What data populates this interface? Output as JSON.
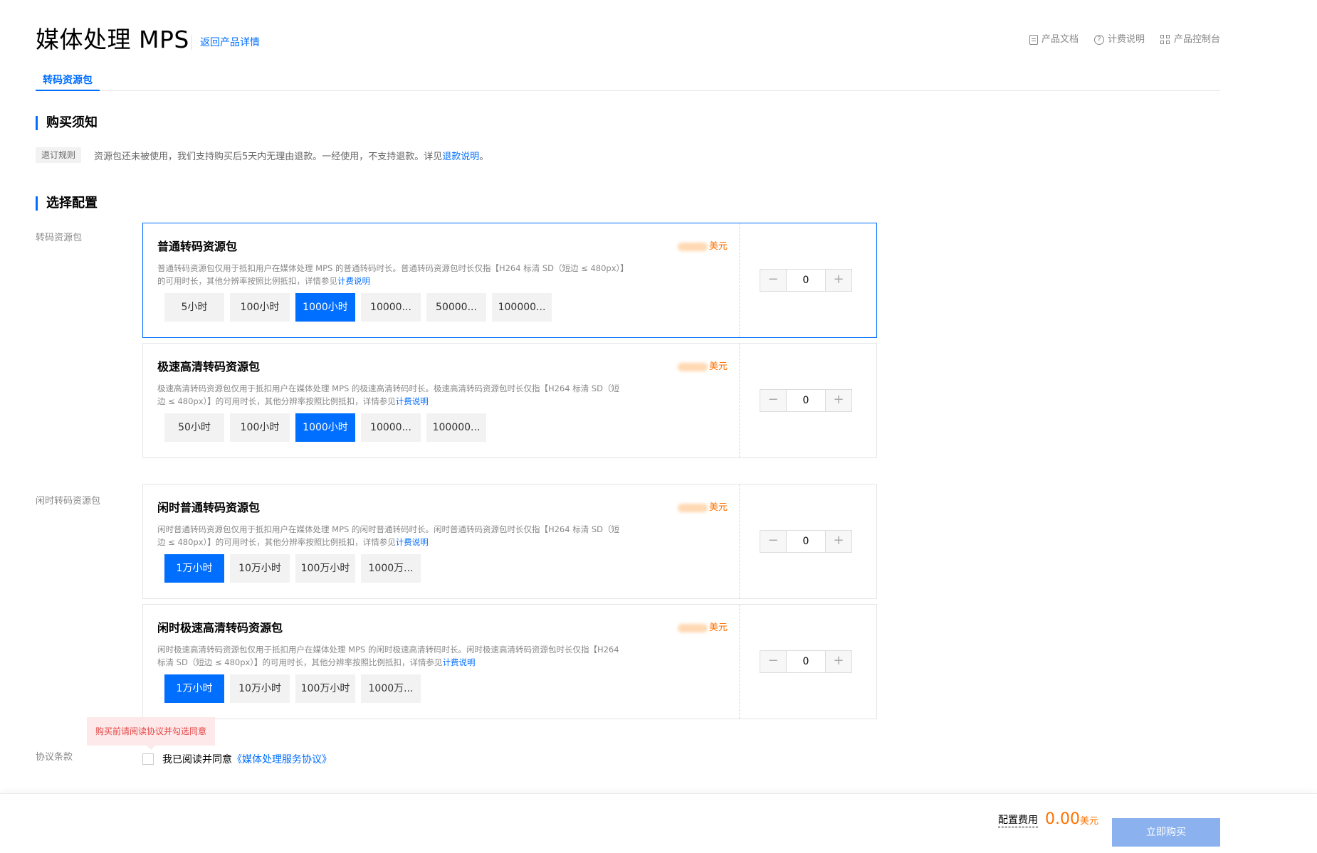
{
  "header": {
    "title": "媒体处理 MPS",
    "back_link": "返回产品详情",
    "links": [
      {
        "label": "产品文档",
        "icon": "document-icon"
      },
      {
        "label": "计费说明",
        "icon": "help-circle-icon"
      },
      {
        "label": "产品控制台",
        "icon": "grid-icon"
      }
    ]
  },
  "tabs": [
    {
      "label": "转码资源包",
      "active": true
    }
  ],
  "notice": {
    "title": "购买须知",
    "tag": "退订规则",
    "text": "资源包还未被使用，我们支持购买后5天内无理由退款。一经使用，不支持退款。详见",
    "link": "退款说明",
    "suffix": "。"
  },
  "config": {
    "title": "选择配置",
    "group_transcode_label": "转码资源包",
    "group_idle_label": "闲时转码资源包"
  },
  "cards": [
    {
      "title": "普通转码资源包",
      "price_unit": "美元",
      "desc": "普通转码资源包仅用于抵扣用户在媒体处理 MPS 的普通转码时长。普通转码资源包时长仅指【H264 标清 SD（短边 ≤ 480px）】的可用时长，其他分辨率按照比例抵扣，详情参见",
      "desc_link": "计费说明",
      "options": [
        "5小时",
        "100小时",
        "1000小时",
        "10000...",
        "50000...",
        "100000..."
      ],
      "selected_index": 2,
      "quantity": "0"
    },
    {
      "title": "极速高清转码资源包",
      "price_unit": "美元",
      "desc": "极速高清转码资源包仅用于抵扣用户在媒体处理 MPS 的极速高清转码时长。极速高清转码资源包时长仅指【H264 标清 SD（短边 ≤ 480px）】的可用时长，其他分辨率按照比例抵扣，详情参见",
      "desc_link": "计费说明",
      "options": [
        "50小时",
        "100小时",
        "1000小时",
        "10000...",
        "100000..."
      ],
      "selected_index": 2,
      "quantity": "0"
    },
    {
      "title": "闲时普通转码资源包",
      "price_unit": "美元",
      "desc": "闲时普通转码资源包仅用于抵扣用户在媒体处理 MPS 的闲时普通转码时长。闲时普通转码资源包时长仅指【H264 标清 SD（短边 ≤ 480px）】的可用时长，其他分辨率按照比例抵扣，详情参见",
      "desc_link": "计费说明",
      "options": [
        "1万小时",
        "10万小时",
        "100万小时",
        "1000万..."
      ],
      "selected_index": 0,
      "quantity": "0"
    },
    {
      "title": "闲时极速高清转码资源包",
      "price_unit": "美元",
      "desc": "闲时极速高清转码资源包仅用于抵扣用户在媒体处理 MPS 的闲时极速高清转码时长。闲时极速高清转码资源包时长仅指【H264 标清 SD（短边 ≤ 480px）】的可用时长，其他分辨率按照比例抵扣，详情参见",
      "desc_link": "计费说明",
      "options": [
        "1万小时",
        "10万小时",
        "100万小时",
        "1000万..."
      ],
      "selected_index": 0,
      "quantity": "0"
    }
  ],
  "stepper": {
    "minus": "−",
    "plus": "+"
  },
  "agreement": {
    "label": "协议条款",
    "warning": "购买前请阅读协议并勾选同意",
    "text": "我已阅读并同意",
    "link": "《媒体处理服务协议》"
  },
  "footer": {
    "fee_label": "配置费用",
    "amount": "0.00",
    "unit": "美元",
    "buy_button": "立即购买"
  },
  "colors": {
    "accent": "#006eff",
    "price": "#ff7200",
    "buy_disabled": "#8bb2ee"
  }
}
